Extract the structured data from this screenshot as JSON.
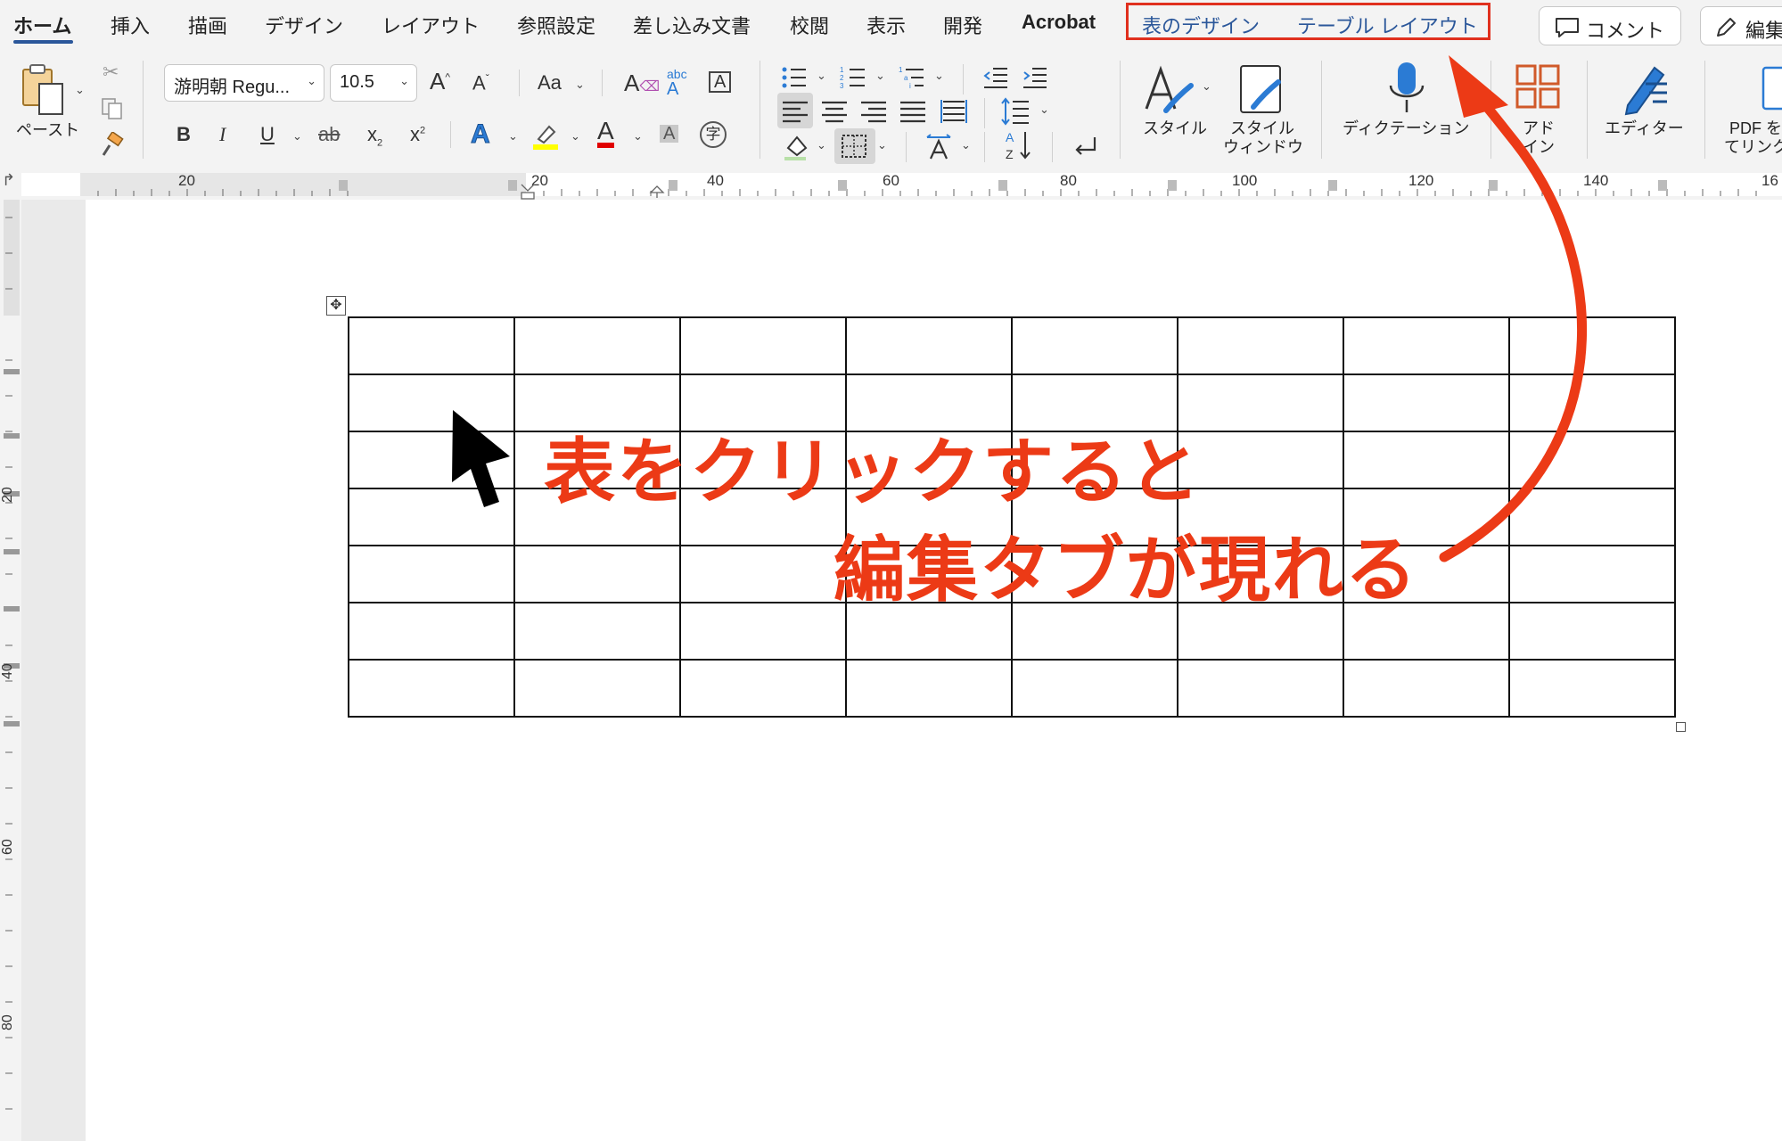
{
  "tabs": [
    {
      "label": "ホーム"
    },
    {
      "label": "挿入"
    },
    {
      "label": "描画"
    },
    {
      "label": "デザイン"
    },
    {
      "label": "レイアウト"
    },
    {
      "label": "参照設定"
    },
    {
      "label": "差し込み文書"
    },
    {
      "label": "校閲"
    },
    {
      "label": "表示"
    },
    {
      "label": "開発"
    },
    {
      "label": "Acrobat"
    }
  ],
  "context_tabs": [
    {
      "label": "表のデザイン"
    },
    {
      "label": "テーブル レイアウト"
    }
  ],
  "header_buttons": {
    "comment": "コメント",
    "edit": "編集"
  },
  "ribbon": {
    "paste": "ペースト",
    "font_name": "游明朝 Regu...",
    "font_size": "10.5",
    "styles": "スタイル",
    "styles_pane_line1": "スタイル",
    "styles_pane_line2": "ウィンドウ",
    "dictate": "ディクテーション",
    "addins_line1": "アド",
    "addins_line2": "イン",
    "editor": "エディター",
    "pdf_line1": "PDF を",
    "pdf_line2": "てリンク"
  },
  "ruler": {
    "h_numbers": [
      "20",
      "20",
      "40",
      "60",
      "80",
      "100",
      "120",
      "140",
      "16"
    ],
    "v_numbers": [
      "20",
      "40",
      "60",
      "80"
    ]
  },
  "table": {
    "rows": 7,
    "cols": 8
  },
  "annotations": {
    "line1": "表をクリックすると",
    "line2": "編集タブが現れる"
  },
  "colors": {
    "accent": "#2b579a",
    "annotation": "#ec3a16",
    "highlight_box": "#e0301e",
    "highlighter_yellow": "#ffff00",
    "font_color_red": "#e00000"
  }
}
